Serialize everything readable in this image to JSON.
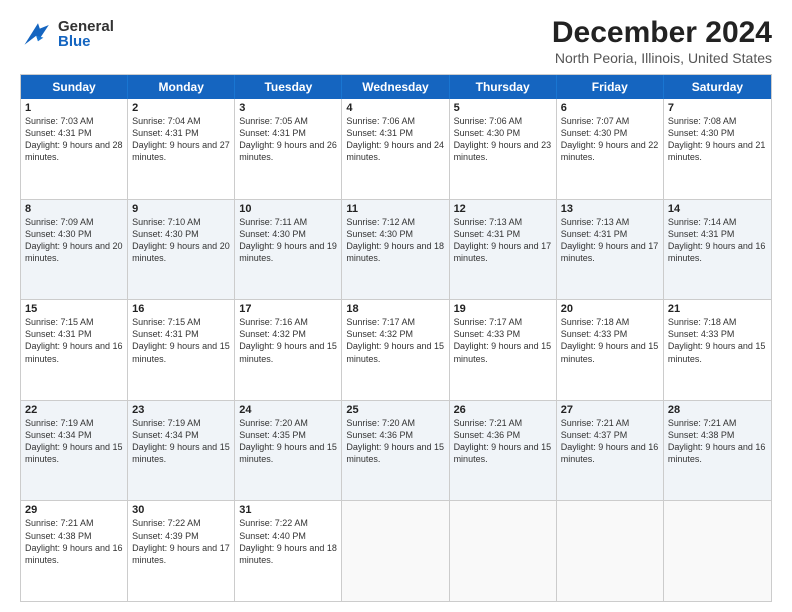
{
  "header": {
    "logo_general": "General",
    "logo_blue": "Blue",
    "main_title": "December 2024",
    "subtitle": "North Peoria, Illinois, United States"
  },
  "calendar": {
    "days": [
      "Sunday",
      "Monday",
      "Tuesday",
      "Wednesday",
      "Thursday",
      "Friday",
      "Saturday"
    ],
    "rows": [
      [
        {
          "day": "1",
          "sunrise": "Sunrise: 7:03 AM",
          "sunset": "Sunset: 4:31 PM",
          "daylight": "Daylight: 9 hours and 28 minutes."
        },
        {
          "day": "2",
          "sunrise": "Sunrise: 7:04 AM",
          "sunset": "Sunset: 4:31 PM",
          "daylight": "Daylight: 9 hours and 27 minutes."
        },
        {
          "day": "3",
          "sunrise": "Sunrise: 7:05 AM",
          "sunset": "Sunset: 4:31 PM",
          "daylight": "Daylight: 9 hours and 26 minutes."
        },
        {
          "day": "4",
          "sunrise": "Sunrise: 7:06 AM",
          "sunset": "Sunset: 4:31 PM",
          "daylight": "Daylight: 9 hours and 24 minutes."
        },
        {
          "day": "5",
          "sunrise": "Sunrise: 7:06 AM",
          "sunset": "Sunset: 4:30 PM",
          "daylight": "Daylight: 9 hours and 23 minutes."
        },
        {
          "day": "6",
          "sunrise": "Sunrise: 7:07 AM",
          "sunset": "Sunset: 4:30 PM",
          "daylight": "Daylight: 9 hours and 22 minutes."
        },
        {
          "day": "7",
          "sunrise": "Sunrise: 7:08 AM",
          "sunset": "Sunset: 4:30 PM",
          "daylight": "Daylight: 9 hours and 21 minutes."
        }
      ],
      [
        {
          "day": "8",
          "sunrise": "Sunrise: 7:09 AM",
          "sunset": "Sunset: 4:30 PM",
          "daylight": "Daylight: 9 hours and 20 minutes."
        },
        {
          "day": "9",
          "sunrise": "Sunrise: 7:10 AM",
          "sunset": "Sunset: 4:30 PM",
          "daylight": "Daylight: 9 hours and 20 minutes."
        },
        {
          "day": "10",
          "sunrise": "Sunrise: 7:11 AM",
          "sunset": "Sunset: 4:30 PM",
          "daylight": "Daylight: 9 hours and 19 minutes."
        },
        {
          "day": "11",
          "sunrise": "Sunrise: 7:12 AM",
          "sunset": "Sunset: 4:30 PM",
          "daylight": "Daylight: 9 hours and 18 minutes."
        },
        {
          "day": "12",
          "sunrise": "Sunrise: 7:13 AM",
          "sunset": "Sunset: 4:31 PM",
          "daylight": "Daylight: 9 hours and 17 minutes."
        },
        {
          "day": "13",
          "sunrise": "Sunrise: 7:13 AM",
          "sunset": "Sunset: 4:31 PM",
          "daylight": "Daylight: 9 hours and 17 minutes."
        },
        {
          "day": "14",
          "sunrise": "Sunrise: 7:14 AM",
          "sunset": "Sunset: 4:31 PM",
          "daylight": "Daylight: 9 hours and 16 minutes."
        }
      ],
      [
        {
          "day": "15",
          "sunrise": "Sunrise: 7:15 AM",
          "sunset": "Sunset: 4:31 PM",
          "daylight": "Daylight: 9 hours and 16 minutes."
        },
        {
          "day": "16",
          "sunrise": "Sunrise: 7:15 AM",
          "sunset": "Sunset: 4:31 PM",
          "daylight": "Daylight: 9 hours and 15 minutes."
        },
        {
          "day": "17",
          "sunrise": "Sunrise: 7:16 AM",
          "sunset": "Sunset: 4:32 PM",
          "daylight": "Daylight: 9 hours and 15 minutes."
        },
        {
          "day": "18",
          "sunrise": "Sunrise: 7:17 AM",
          "sunset": "Sunset: 4:32 PM",
          "daylight": "Daylight: 9 hours and 15 minutes."
        },
        {
          "day": "19",
          "sunrise": "Sunrise: 7:17 AM",
          "sunset": "Sunset: 4:33 PM",
          "daylight": "Daylight: 9 hours and 15 minutes."
        },
        {
          "day": "20",
          "sunrise": "Sunrise: 7:18 AM",
          "sunset": "Sunset: 4:33 PM",
          "daylight": "Daylight: 9 hours and 15 minutes."
        },
        {
          "day": "21",
          "sunrise": "Sunrise: 7:18 AM",
          "sunset": "Sunset: 4:33 PM",
          "daylight": "Daylight: 9 hours and 15 minutes."
        }
      ],
      [
        {
          "day": "22",
          "sunrise": "Sunrise: 7:19 AM",
          "sunset": "Sunset: 4:34 PM",
          "daylight": "Daylight: 9 hours and 15 minutes."
        },
        {
          "day": "23",
          "sunrise": "Sunrise: 7:19 AM",
          "sunset": "Sunset: 4:34 PM",
          "daylight": "Daylight: 9 hours and 15 minutes."
        },
        {
          "day": "24",
          "sunrise": "Sunrise: 7:20 AM",
          "sunset": "Sunset: 4:35 PM",
          "daylight": "Daylight: 9 hours and 15 minutes."
        },
        {
          "day": "25",
          "sunrise": "Sunrise: 7:20 AM",
          "sunset": "Sunset: 4:36 PM",
          "daylight": "Daylight: 9 hours and 15 minutes."
        },
        {
          "day": "26",
          "sunrise": "Sunrise: 7:21 AM",
          "sunset": "Sunset: 4:36 PM",
          "daylight": "Daylight: 9 hours and 15 minutes."
        },
        {
          "day": "27",
          "sunrise": "Sunrise: 7:21 AM",
          "sunset": "Sunset: 4:37 PM",
          "daylight": "Daylight: 9 hours and 16 minutes."
        },
        {
          "day": "28",
          "sunrise": "Sunrise: 7:21 AM",
          "sunset": "Sunset: 4:38 PM",
          "daylight": "Daylight: 9 hours and 16 minutes."
        }
      ],
      [
        {
          "day": "29",
          "sunrise": "Sunrise: 7:21 AM",
          "sunset": "Sunset: 4:38 PM",
          "daylight": "Daylight: 9 hours and 16 minutes."
        },
        {
          "day": "30",
          "sunrise": "Sunrise: 7:22 AM",
          "sunset": "Sunset: 4:39 PM",
          "daylight": "Daylight: 9 hours and 17 minutes."
        },
        {
          "day": "31",
          "sunrise": "Sunrise: 7:22 AM",
          "sunset": "Sunset: 4:40 PM",
          "daylight": "Daylight: 9 hours and 18 minutes."
        },
        {
          "day": "",
          "sunrise": "",
          "sunset": "",
          "daylight": ""
        },
        {
          "day": "",
          "sunrise": "",
          "sunset": "",
          "daylight": ""
        },
        {
          "day": "",
          "sunrise": "",
          "sunset": "",
          "daylight": ""
        },
        {
          "day": "",
          "sunrise": "",
          "sunset": "",
          "daylight": ""
        }
      ]
    ]
  }
}
